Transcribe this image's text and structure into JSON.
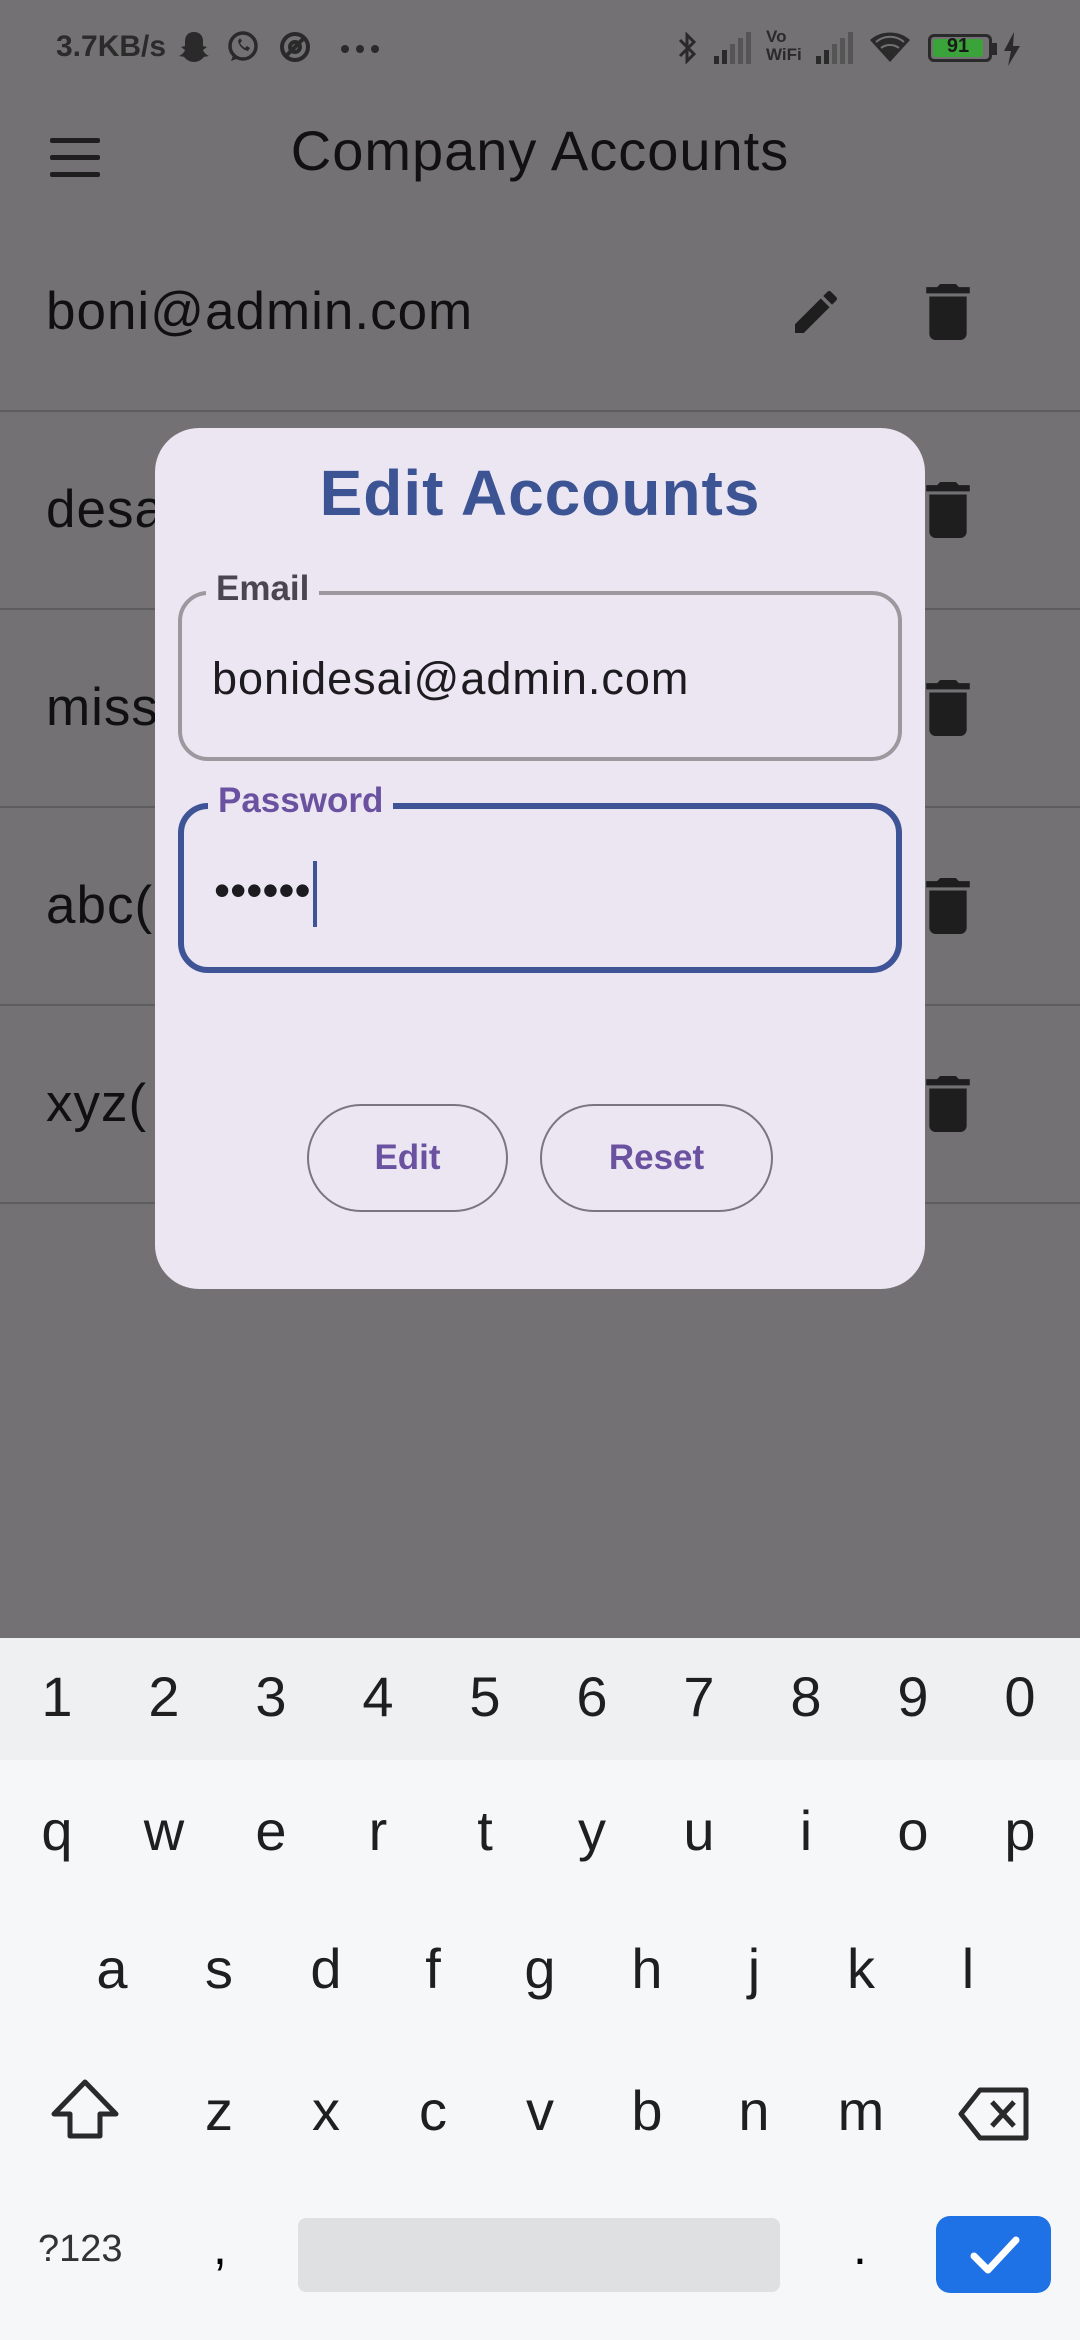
{
  "status_bar": {
    "network_speed": "3.7KB/s",
    "battery_level": "91",
    "icons": [
      "snapchat-icon",
      "whatsapp-icon",
      "vpn-icon",
      "more-icon",
      "bluetooth-icon",
      "signal-icon",
      "vowifi-icon",
      "signal-icon-2",
      "wifi-icon",
      "battery-icon",
      "charging-icon"
    ],
    "vowifi_text_1": "Vo",
    "vowifi_text_2": "WiFi"
  },
  "app_bar": {
    "title": "Company Accounts",
    "menu_icon": "menu-icon"
  },
  "accounts": [
    {
      "email": "boni@admin.com"
    },
    {
      "email": "desa"
    },
    {
      "email": "miss"
    },
    {
      "email": "abc("
    },
    {
      "email": "xyz("
    }
  ],
  "dialog": {
    "title": "Edit Accounts",
    "email_label": "Email",
    "email_value": "bonidesai@admin.com",
    "password_label": "Password",
    "password_value": "••••••",
    "edit_button": "Edit",
    "reset_button": "Reset"
  },
  "keyboard": {
    "number_row": [
      "1",
      "2",
      "3",
      "4",
      "5",
      "6",
      "7",
      "8",
      "9",
      "0"
    ],
    "row1": [
      "q",
      "w",
      "e",
      "r",
      "t",
      "y",
      "u",
      "i",
      "o",
      "p"
    ],
    "row2": [
      "a",
      "s",
      "d",
      "f",
      "g",
      "h",
      "j",
      "k",
      "l"
    ],
    "row3": [
      "z",
      "x",
      "c",
      "v",
      "b",
      "n",
      "m"
    ],
    "symbols_key": "?123",
    "comma_key": ",",
    "period_key": "."
  },
  "colors": {
    "scrim": "#737174",
    "dialog_bg": "#ece6f3",
    "primary": "#3c5494",
    "label_purple": "#6a52a0",
    "enter_key": "#1f71e6"
  }
}
